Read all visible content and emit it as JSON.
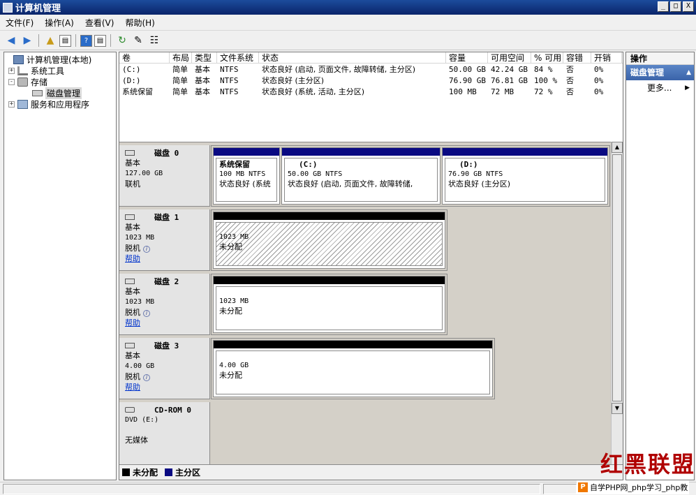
{
  "window": {
    "title": "计算机管理",
    "buttons": [
      "_",
      "□",
      "X"
    ]
  },
  "menu": [
    "文件(F)",
    "操作(A)",
    "查看(V)",
    "帮助(H)"
  ],
  "toolbar": {
    "icons": [
      "back-arrow-icon",
      "forward-arrow-icon",
      "up-folder-icon",
      "show-hide-tree-icon",
      "help-icon",
      "properties-icon",
      "refresh-icon",
      "export-icon",
      "action-icon"
    ]
  },
  "tree": {
    "root": "计算机管理(本地)",
    "system_tools": "系统工具",
    "storage": "存储",
    "disk_management": "磁盘管理",
    "services": "服务和应用程序"
  },
  "volumes": {
    "headers": [
      "卷",
      "布局",
      "类型",
      "文件系统",
      "状态",
      "容量",
      "可用空间",
      "% 可用",
      "容错",
      "开销"
    ],
    "rows": [
      [
        "(C:)",
        "简单",
        "基本",
        "NTFS",
        "状态良好 (启动, 页面文件, 故障转储, 主分区)",
        "50.00 GB",
        "42.24 GB",
        "84 %",
        "否",
        "0%"
      ],
      [
        "(D:)",
        "简单",
        "基本",
        "NTFS",
        "状态良好 (主分区)",
        "76.90 GB",
        "76.81 GB",
        "100 %",
        "否",
        "0%"
      ],
      [
        "系统保留",
        "简单",
        "基本",
        "NTFS",
        "状态良好 (系统, 活动, 主分区)",
        "100 MB",
        "72 MB",
        "72 %",
        "否",
        "0%"
      ]
    ]
  },
  "disks": {
    "d0": {
      "name": "磁盘 0",
      "type": "基本",
      "size": "127.00 GB",
      "status": "联机",
      "p1": {
        "name": "系统保留",
        "fs": "100 MB NTFS",
        "status": "状态良好 (系统"
      },
      "p2": {
        "name": "(C:)",
        "fs": "50.00 GB NTFS",
        "status": "状态良好 (启动, 页面文件, 故障转储,"
      },
      "p3": {
        "name": "(D:)",
        "fs": "76.90 GB NTFS",
        "status": "状态良好 (主分区)"
      }
    },
    "d1": {
      "name": "磁盘 1",
      "type": "基本",
      "size": "1023 MB",
      "status": "脱机",
      "help": "帮助",
      "p_size": "1023 MB",
      "p_status": "未分配"
    },
    "d2": {
      "name": "磁盘 2",
      "type": "基本",
      "size": "1023 MB",
      "status": "脱机",
      "help": "帮助",
      "p_size": "1023 MB",
      "p_status": "未分配"
    },
    "d3": {
      "name": "磁盘 3",
      "type": "基本",
      "size": "4.00 GB",
      "status": "脱机",
      "help": "帮助",
      "p_size": "4.00 GB",
      "p_status": "未分配"
    },
    "cd": {
      "name": "CD-ROM 0",
      "type": "DVD (E:)",
      "status": "无媒体"
    }
  },
  "legend": {
    "unallocated": "未分配",
    "primary": "主分区",
    "unallocated_color": "#000000",
    "primary_color": "#0a0a82"
  },
  "actions": {
    "header": "操作",
    "section": "磁盘管理",
    "more": "更多..."
  },
  "watermark": {
    "brand": "红黑联盟",
    "site": "自学PHP网_php学习_php教"
  }
}
